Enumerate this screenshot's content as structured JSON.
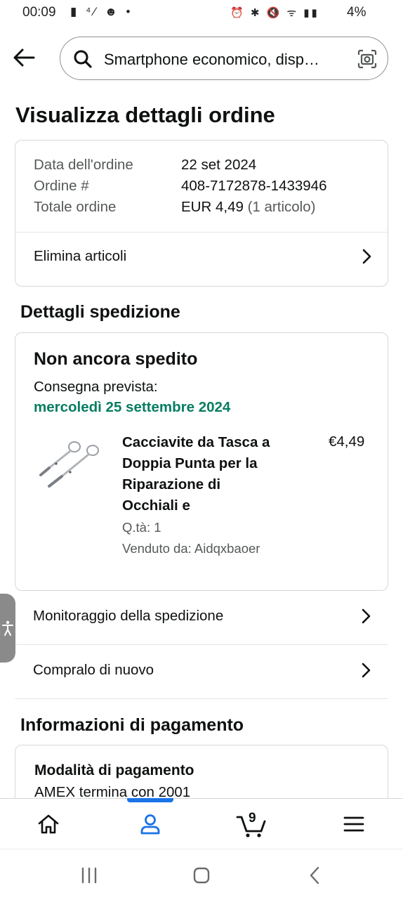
{
  "status_bar": {
    "time": "00:09",
    "left_icons": "▮ ⁴⁄ ☻ •",
    "right_icons": "⏰ ✱ 🔇 ᯤ ▮▮",
    "battery": "4%"
  },
  "header": {
    "search_text": "Smartphone economico, disp…"
  },
  "page_title": "Visualizza dettagli ordine",
  "order_summary": {
    "date_label": "Data dell'ordine",
    "date_value": "22 set 2024",
    "number_label": "Ordine #",
    "number_value": "408-7172878-1433946",
    "total_label": "Totale ordine",
    "total_value": "EUR 4,49",
    "total_items": "(1 articolo)",
    "remove_items_label": "Elimina articoli"
  },
  "shipping": {
    "section_title": "Dettagli spedizione",
    "status": "Non ancora spedito",
    "delivery_label": "Consegna prevista:",
    "delivery_date": "mercoledì 25 settembre 2024",
    "product": {
      "title_lines": [
        "Cacciavite da Tasca a",
        "Doppia Punta per la",
        "Riparazione di",
        "Occhiali e"
      ],
      "price": "€4,49",
      "quantity": "Q.tà: 1",
      "seller": "Venduto da: Aidqxbaoer"
    },
    "track_label": "Monitoraggio della spedizione",
    "buy_again_label": "Compralo di nuovo"
  },
  "payment": {
    "section_title": "Informazioni di pagamento",
    "method_title": "Modalità di pagamento",
    "method_value": "AMEX  termina con 2001"
  },
  "bottom_nav": {
    "cart_count": "9",
    "items": [
      "home-icon",
      "account-icon",
      "cart-icon",
      "menu-icon"
    ],
    "active": "account-icon"
  },
  "colors": {
    "accent_green": "#067d62",
    "active_blue": "#1a73e8",
    "text": "#0f1111",
    "muted": "#565959",
    "border": "#d5d9d9"
  }
}
